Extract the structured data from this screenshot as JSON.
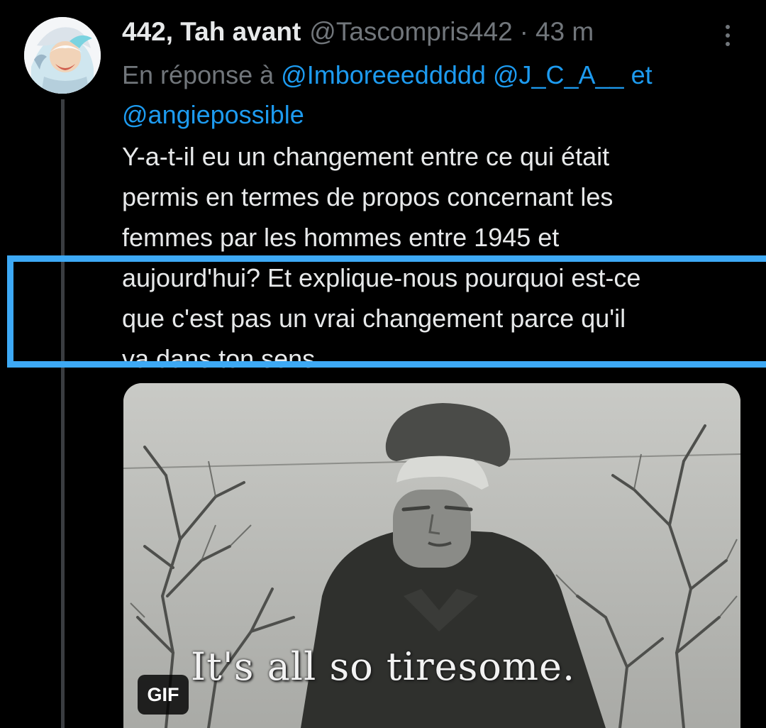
{
  "tweet": {
    "display_name": "442, Tah avant",
    "handle": "@Tascompris442",
    "separator": "·",
    "timestamp": "43 m",
    "reply_prefix": "En réponse à",
    "mentions": [
      "@Imboreeeddddd",
      "@J_C_A__",
      "@angiepossible"
    ],
    "mention_joiner": "et",
    "text_lines": [
      "Y-a-t-il eu un changement entre ce qui était",
      "permis en termes de propos concernant les",
      "femmes par les hommes entre 1945 et",
      "aujourd'hui? Et explique-nous pourquoi est-ce",
      "que c'est pas un vrai changement parce qu'il",
      "va dans ton sens."
    ]
  },
  "media": {
    "type": "GIF",
    "badge_label": "GIF",
    "subtitle": "It's all so tiresome."
  },
  "icons": {
    "more": "more-options-vertical-icon",
    "avatar": "anime-character-avatar"
  },
  "colors": {
    "background": "#000000",
    "text_primary": "#e7e9ea",
    "text_secondary": "#71767b",
    "link": "#1d9bf0",
    "highlight_box": "#3da9f5"
  }
}
